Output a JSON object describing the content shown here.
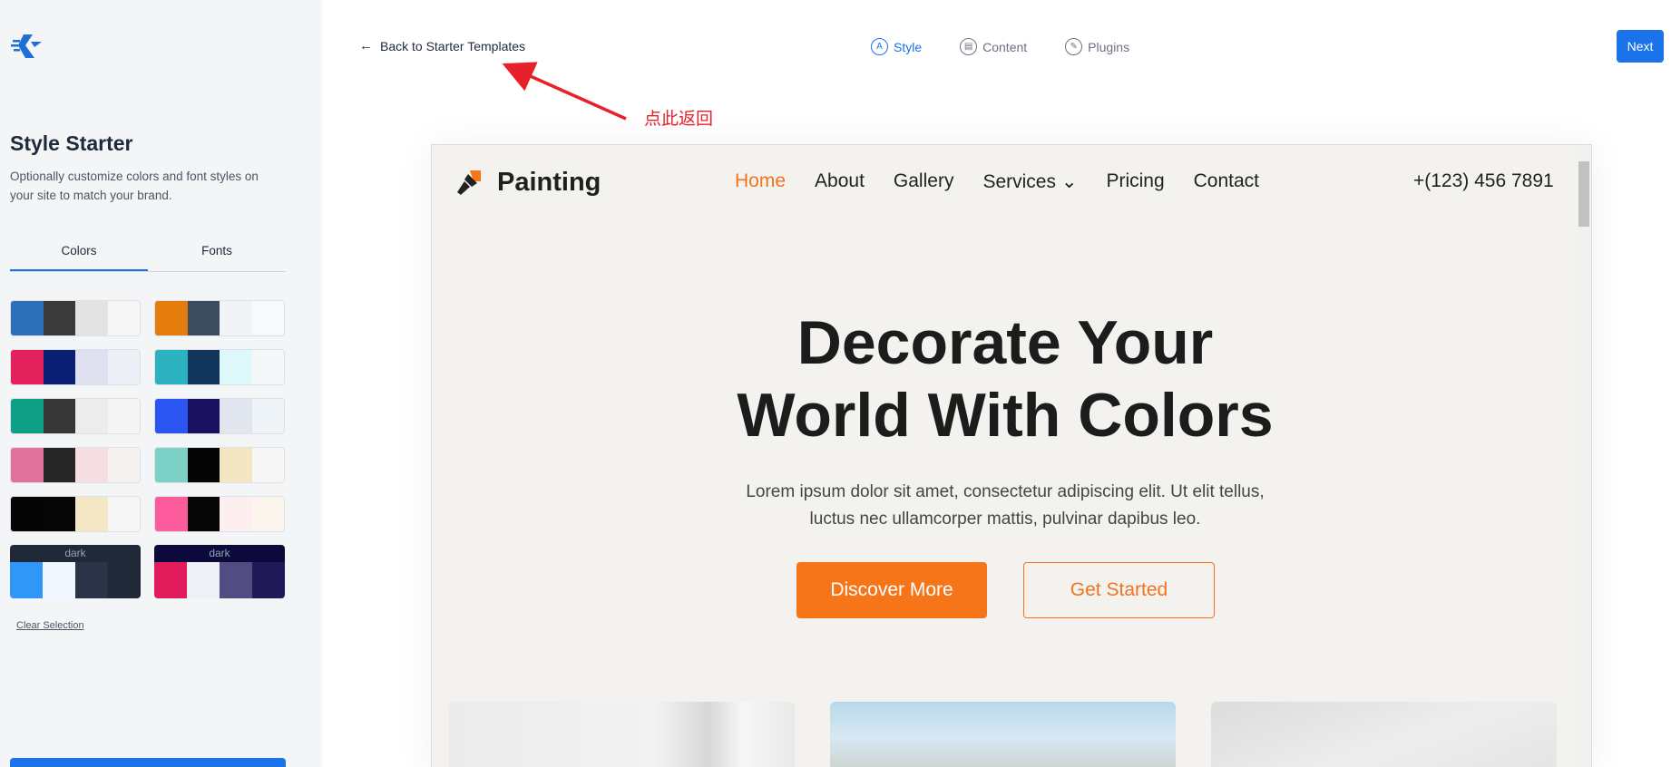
{
  "sidebar": {
    "title": "Style Starter",
    "description": "Optionally customize colors and font styles on your site to match your brand.",
    "tabs": [
      {
        "label": "Colors",
        "active": true
      },
      {
        "label": "Fonts",
        "active": false
      }
    ],
    "palettes": [
      {
        "colors": [
          "#2d6fb8",
          "#3a3a3a",
          "#e3e3e3",
          "#f6f6f6"
        ]
      },
      {
        "colors": [
          "#e57c0e",
          "#3c4b5e",
          "#f1f3f6",
          "#f8f9fb"
        ]
      },
      {
        "colors": [
          "#e3215c",
          "#0b1f74",
          "#dedfef",
          "#eeeff6"
        ]
      },
      {
        "colors": [
          "#2cb1c0",
          "#12355b",
          "#dff8fc",
          "#f5f7f9"
        ]
      },
      {
        "colors": [
          "#0e9f86",
          "#363636",
          "#ececec",
          "#f5f5f5"
        ]
      },
      {
        "colors": [
          "#2a55f0",
          "#1a1060",
          "#e1e6ee",
          "#eef3f7"
        ]
      },
      {
        "colors": [
          "#e0739a",
          "#262626",
          "#f6dfe3",
          "#f5f1ee"
        ]
      },
      {
        "colors": [
          "#7dd1c6",
          "#050505",
          "#f4e6c2",
          "#f7f7f7"
        ]
      },
      {
        "colors": [
          "#050505",
          "#070707",
          "#f5e8c4",
          "#f6f6f6"
        ]
      },
      {
        "colors": [
          "#fd5c9c",
          "#060606",
          "#fdeff0",
          "#fcf5ed"
        ]
      }
    ],
    "dark_palettes": [
      {
        "label": "dark",
        "header": "#1f2937",
        "colors": [
          "#3096f8",
          "#f0f7ff",
          "#2a3446",
          "#1f2937"
        ]
      },
      {
        "label": "dark",
        "header": "#0b0a3b",
        "colors": [
          "#e01c5c",
          "#efeff7",
          "#514c82",
          "#201a58"
        ]
      }
    ],
    "clear_selection": "Clear Selection"
  },
  "topbar": {
    "back_label": "Back to Starter Templates",
    "back_arrow": "←",
    "steps": [
      {
        "label": "Style",
        "icon": "A",
        "active": true
      },
      {
        "label": "Content",
        "icon": "▤",
        "active": false
      },
      {
        "label": "Plugins",
        "icon": "✎",
        "active": false
      }
    ],
    "next_label": "Next"
  },
  "annotation": {
    "text": "点此返回",
    "color": "#e8202a"
  },
  "preview": {
    "brand": "Painting",
    "nav": [
      "Home",
      "About",
      "Gallery",
      "Services",
      "Pricing",
      "Contact"
    ],
    "services_chevron": "⌄",
    "phone": "+(123) 456 7891",
    "hero_line1": "Decorate Your",
    "hero_line2": "World With Colors",
    "sub_line1": "Lorem ipsum dolor sit amet, consectetur adipiscing elit. Ut elit tellus,",
    "sub_line2": "luctus nec ullamcorper mattis, pulvinar dapibus leo.",
    "btn_primary": "Discover More",
    "btn_secondary": "Get Started",
    "accent": "#f67519"
  }
}
